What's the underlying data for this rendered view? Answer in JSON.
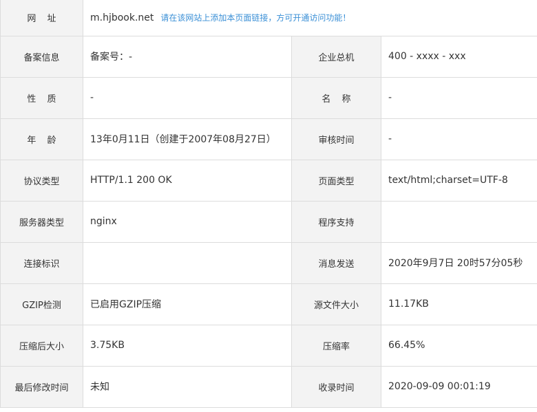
{
  "website": {
    "label": "网 址",
    "domain": "m.hjbook.net",
    "hint": "请在该网站上添加本页面链接，方可开通访问功能！"
  },
  "rows": [
    {
      "left_label": "备案信息",
      "left_value": "备案号：-",
      "right_label": "企业总机",
      "right_value": "400 - xxxx - xxx"
    },
    {
      "left_label": "性 质",
      "left_value": "-",
      "right_label": "名 称",
      "right_value": "-"
    },
    {
      "left_label": "年 龄",
      "left_value": "13年0月11日（创建于2007年08月27日）",
      "right_label": "审核时间",
      "right_value": "-"
    },
    {
      "left_label": "协议类型",
      "left_value": "HTTP/1.1 200 OK",
      "right_label": "页面类型",
      "right_value": "text/html;charset=UTF-8"
    },
    {
      "left_label": "服务器类型",
      "left_value": "nginx",
      "right_label": "程序支持",
      "right_value": ""
    },
    {
      "left_label": "连接标识",
      "left_value": "",
      "right_label": "消息发送",
      "right_value": "2020年9月7日 20时57分05秒"
    },
    {
      "left_label": "GZIP检测",
      "left_value": "已启用GZIP压缩",
      "right_label": "源文件大小",
      "right_value": "11.17KB"
    },
    {
      "left_label": "压缩后大小",
      "left_value": "3.75KB",
      "right_label": "压缩率",
      "right_value": "66.45%"
    },
    {
      "left_label": "最后修改时间",
      "left_value": "未知",
      "right_label": "收录时间",
      "right_value": "2020-09-09 00:01:19"
    }
  ]
}
